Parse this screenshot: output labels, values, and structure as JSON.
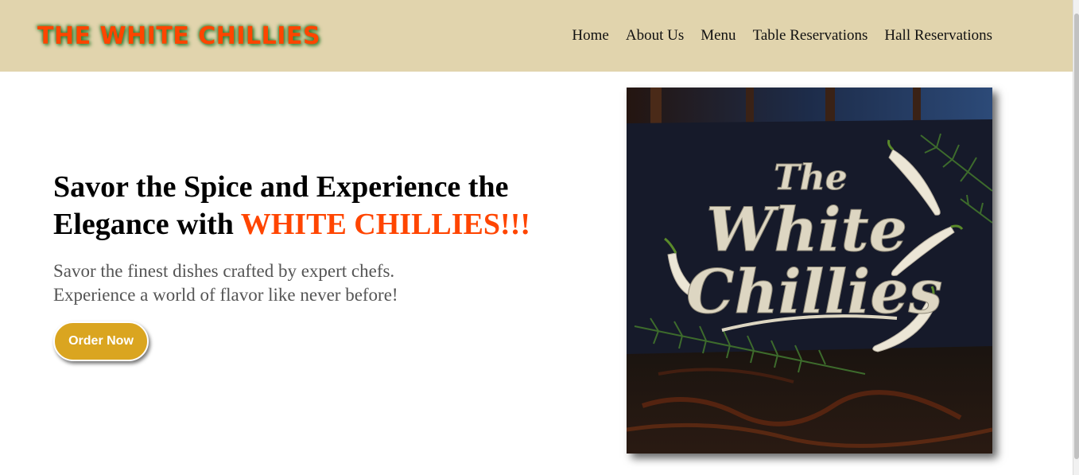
{
  "brand": {
    "name": "THE WHITE CHILLIES",
    "color": "#ff4500",
    "glow": "#2e7d32"
  },
  "nav": {
    "links": [
      "Home",
      "About Us",
      "Menu",
      "Table Reservations",
      "Hall Reservations"
    ],
    "background": "#e1d4ad"
  },
  "hero": {
    "title_prefix": "Savor the Spice and Experience the Elegance with ",
    "title_accent": "WHITE CHILLIES!!!",
    "subtitle_line1": "Savor the finest dishes crafted by expert chefs.",
    "subtitle_line2": "Experience a world of flavor like never before!",
    "cta_label": "Order Now",
    "cta_color": "#daa520",
    "image_text_line1": "The",
    "image_text_line2": "White",
    "image_text_line3": "Chillies"
  }
}
